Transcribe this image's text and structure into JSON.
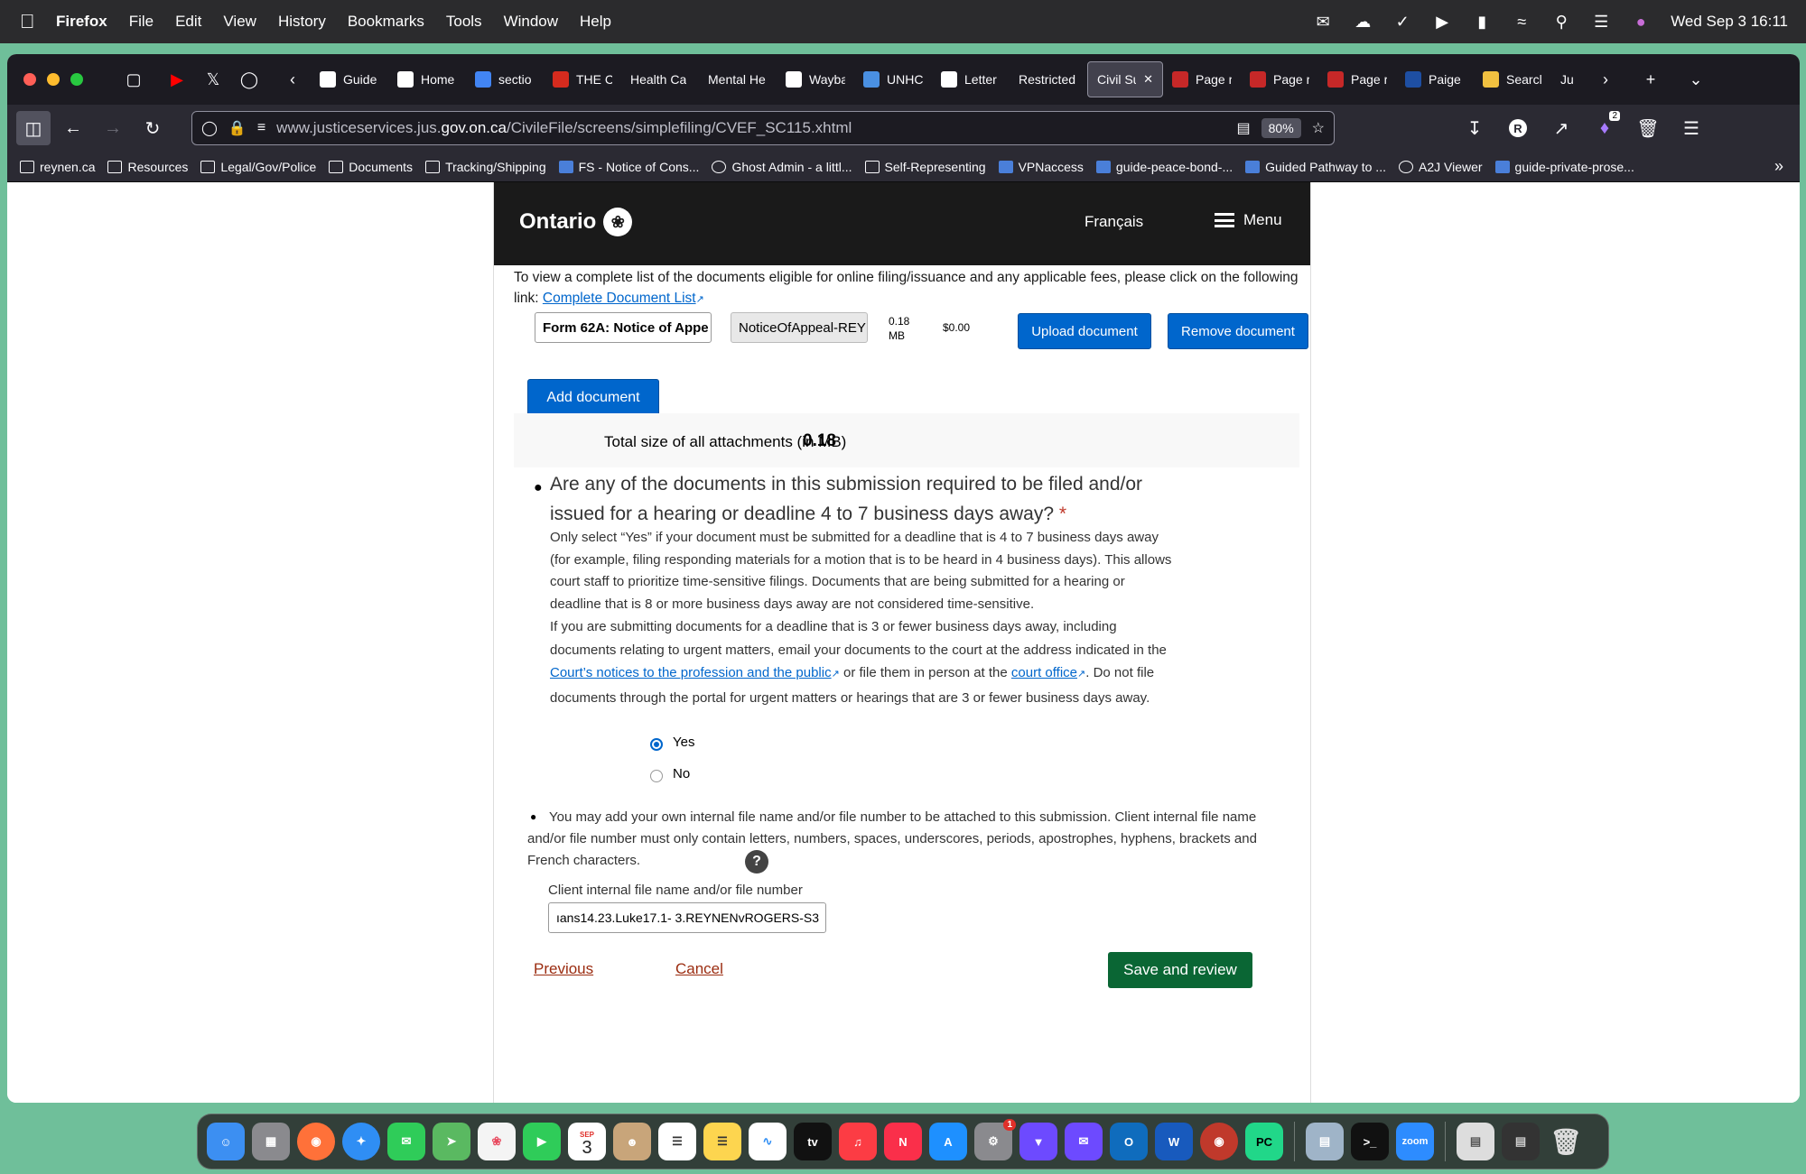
{
  "menubar": {
    "app": "Firefox",
    "items": [
      "File",
      "Edit",
      "View",
      "History",
      "Bookmarks",
      "Tools",
      "Window",
      "Help"
    ],
    "clock": "Wed Sep 3  16:11"
  },
  "tabs": [
    {
      "label": "Guide",
      "icon": "doc-icon",
      "color": "#ffffff"
    },
    {
      "label": "Home",
      "icon": "home-icon",
      "color": "#ffffff"
    },
    {
      "label": "sectio",
      "icon": "google-icon",
      "color": "#4285f4"
    },
    {
      "label": "THE C",
      "icon": "maple-leaf-icon",
      "color": "#d52b1e"
    },
    {
      "label": "Health Ca",
      "icon": "",
      "color": ""
    },
    {
      "label": "Mental He",
      "icon": "",
      "color": ""
    },
    {
      "label": "Wayba",
      "icon": "archive-icon",
      "color": "#ffffff"
    },
    {
      "label": "UNHC",
      "icon": "un-icon",
      "color": "#4a90e2"
    },
    {
      "label": "Letter",
      "icon": "cross-icon",
      "color": "#ffffff"
    },
    {
      "label": "Restricted",
      "icon": "",
      "color": ""
    },
    {
      "label": "Civil Su",
      "icon": "",
      "color": "",
      "active": true
    },
    {
      "label": "Page r",
      "icon": "scj-icon",
      "color": "#c62828"
    },
    {
      "label": "Page r",
      "icon": "scj-icon",
      "color": "#c62828"
    },
    {
      "label": "Page r",
      "icon": "scj-icon",
      "color": "#c62828"
    },
    {
      "label": "Paige",
      "icon": "alis-icon",
      "color": "#1e4fa3"
    },
    {
      "label": "Searcl",
      "icon": "search-site-icon",
      "color": "#f0c040"
    },
    {
      "label": "Ju",
      "icon": "",
      "color": ""
    }
  ],
  "urlbar": {
    "url_prefix": "www.justiceservices.jus.",
    "url_domain": "gov.on.ca",
    "url_path": "/CivileFile/screens/simplefiling/CVEF_SC115.xhtml",
    "zoom": "80%"
  },
  "bookmarks": [
    {
      "label": "reynen.ca",
      "icon": "folder"
    },
    {
      "label": "Resources",
      "icon": "folder"
    },
    {
      "label": "Legal/Gov/Police",
      "icon": "folder"
    },
    {
      "label": "Documents",
      "icon": "folder"
    },
    {
      "label": "Tracking/Shipping",
      "icon": "folder"
    },
    {
      "label": "FS - Notice of Cons...",
      "icon": "fav"
    },
    {
      "label": "Ghost Admin - a littl...",
      "icon": "globe"
    },
    {
      "label": "Self-Representing",
      "icon": "folder"
    },
    {
      "label": "VPNaccess",
      "icon": "fav"
    },
    {
      "label": "guide-peace-bond-...",
      "icon": "fav"
    },
    {
      "label": "Guided Pathway to ...",
      "icon": "fav"
    },
    {
      "label": "A2J Viewer",
      "icon": "globe"
    },
    {
      "label": "guide-private-prose...",
      "icon": "fav"
    }
  ],
  "header": {
    "logo": "Ontario",
    "francais": "Français",
    "menu": "Menu"
  },
  "intro": {
    "text": "To view a complete list of the documents eligible for online filing/issuance and any applicable fees, please click on the following link: ",
    "link": "Complete Document List"
  },
  "document_row": {
    "form_name": "Form 62A: Notice of Appe",
    "file_name": "NoticeOfAppeal-REY",
    "size": "0.18 MB",
    "fee": "$0.00",
    "upload_label": "Upload document",
    "remove_label": "Remove document"
  },
  "add_document_label": "Add document",
  "total": {
    "label": "Total size of all attachments (in MB)",
    "value": "0.18"
  },
  "question": {
    "title": "Are any of the documents in this submission required to be filed and/or issued for a hearing or deadline 4 to 7 business days away?",
    "required_mark": "*",
    "para1": "Only select “Yes” if your document must be submitted for a deadline that is 4 to 7 business days away (for example, filing responding materials for a motion that is to be heard in 4 business days). This allows court staff to prioritize time-sensitive filings. Documents that are being submitted for a hearing or deadline that is 8 or more business days away are not considered time-sensitive.",
    "para2_a": "If you are submitting documents for a deadline that is 3 or fewer business days away, including documents relating to urgent matters, email your documents to the court at the address indicated in the ",
    "para2_link1": "Court’s notices to the profession and the public",
    "para2_b": " or file them in person at the ",
    "para2_link2": "court office",
    "para2_c": ". Do not file documents through the portal for urgent matters or hearings that are 3 or fewer business days away.",
    "option_yes": "Yes",
    "option_no": "No",
    "selected": "Yes"
  },
  "client_file": {
    "note": "You may add your own internal file name and/or file number to be attached to this submission. Client internal file name and/or file number must only contain letters, numbers, spaces, underscores, periods, apostrophes, hyphens, brackets and French characters.",
    "help": "?",
    "field_label": "Client internal file name and/or file number",
    "field_value": "ıans14.23.Luke17.1- 3.REYNENvROGERS-S3"
  },
  "footer": {
    "previous": "Previous",
    "cancel": "Cancel",
    "save": "Save and review"
  },
  "dock": {
    "calendar_month": "SEP",
    "calendar_day": "3",
    "settings_badge": "1",
    "appletv": "tv",
    "zoom_label": "zoom",
    "pycharm_label": "PC"
  },
  "extensions_badge": "2"
}
